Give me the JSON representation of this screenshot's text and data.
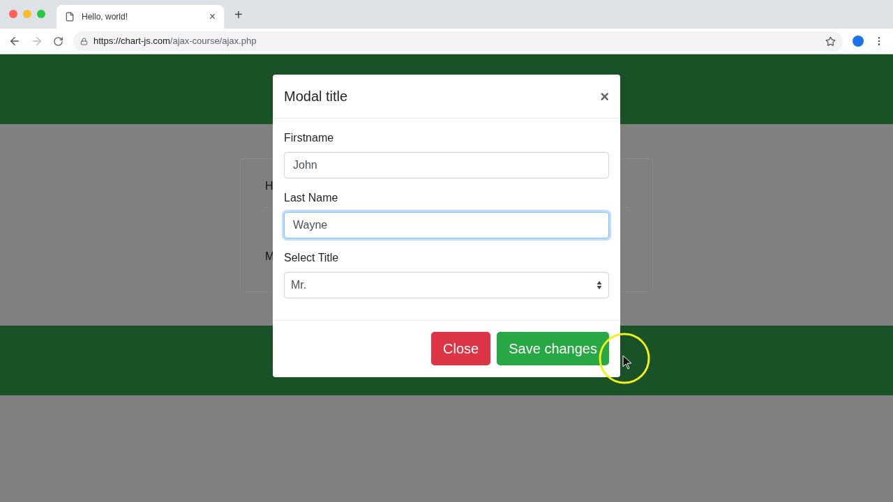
{
  "browser": {
    "tab": {
      "title": "Hello, world!",
      "close": "×"
    },
    "new_tab": "+",
    "url": {
      "host": "https://chart-js.com",
      "path": "/ajax-course/ajax.php"
    }
  },
  "background_card": {
    "texts": [
      "H",
      "M"
    ]
  },
  "modal": {
    "title": "Modal title",
    "close": "×",
    "fields": [
      {
        "kind": "text",
        "label": "Firstname",
        "value": "John",
        "focused": false
      },
      {
        "kind": "text",
        "label": "Last Name",
        "value": "Wayne",
        "focused": true
      },
      {
        "kind": "select",
        "label": "Select Title",
        "value": "Mr."
      }
    ],
    "buttons": [
      {
        "kind": "danger",
        "label": "Close"
      },
      {
        "kind": "success",
        "label": "Save changes"
      }
    ]
  }
}
